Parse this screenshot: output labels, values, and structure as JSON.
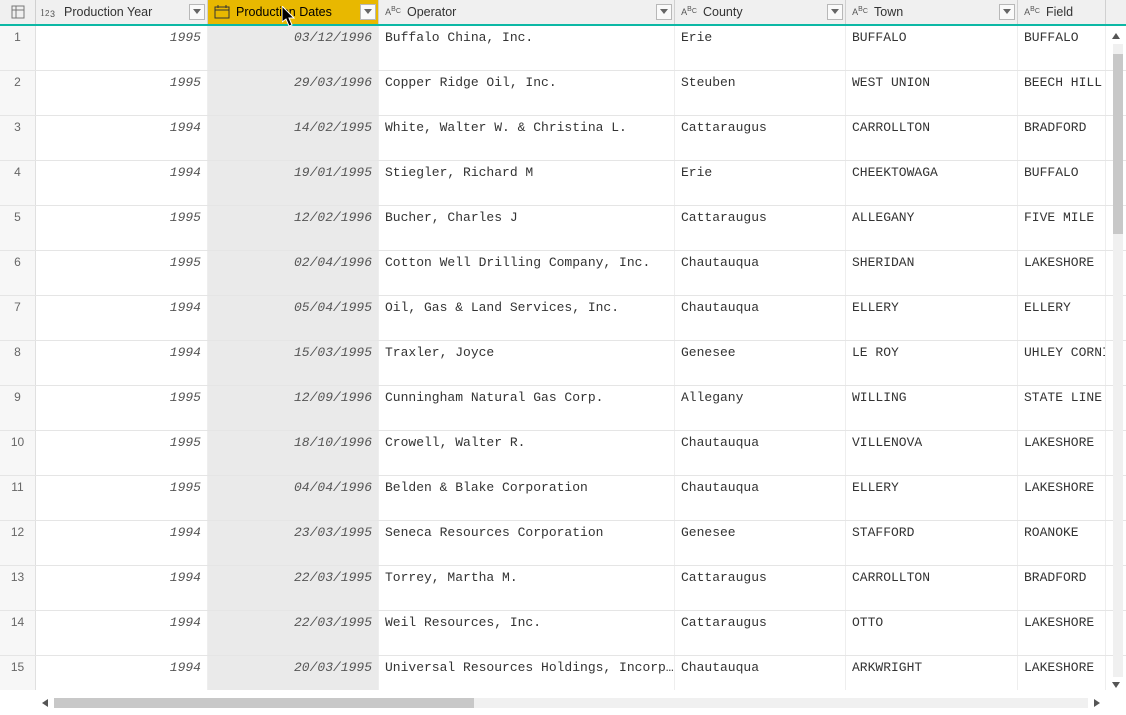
{
  "columns": [
    {
      "key": "year",
      "label": "Production Year",
      "type": "number",
      "selected": false
    },
    {
      "key": "dates",
      "label": "Production Dates",
      "type": "date",
      "selected": true
    },
    {
      "key": "operator",
      "label": "Operator",
      "type": "text",
      "selected": false
    },
    {
      "key": "county",
      "label": "County",
      "type": "text",
      "selected": false
    },
    {
      "key": "town",
      "label": "Town",
      "type": "text",
      "selected": false
    },
    {
      "key": "field",
      "label": "Field",
      "type": "text",
      "selected": false
    }
  ],
  "rows": [
    {
      "n": 1,
      "year": "1995",
      "dates": "03/12/1996",
      "operator": "Buffalo China, Inc.",
      "county": "Erie",
      "town": "BUFFALO",
      "field": "BUFFALO"
    },
    {
      "n": 2,
      "year": "1995",
      "dates": "29/03/1996",
      "operator": "Copper Ridge Oil, Inc.",
      "county": "Steuben",
      "town": "WEST UNION",
      "field": "BEECH HILL"
    },
    {
      "n": 3,
      "year": "1994",
      "dates": "14/02/1995",
      "operator": "White, Walter W. & Christina L.",
      "county": "Cattaraugus",
      "town": "CARROLLTON",
      "field": "BRADFORD"
    },
    {
      "n": 4,
      "year": "1994",
      "dates": "19/01/1995",
      "operator": "Stiegler, Richard M",
      "county": "Erie",
      "town": "CHEEKTOWAGA",
      "field": "BUFFALO"
    },
    {
      "n": 5,
      "year": "1995",
      "dates": "12/02/1996",
      "operator": "Bucher, Charles J",
      "county": "Cattaraugus",
      "town": "ALLEGANY",
      "field": "FIVE MILE"
    },
    {
      "n": 6,
      "year": "1995",
      "dates": "02/04/1996",
      "operator": "Cotton Well Drilling Company,  Inc.",
      "county": "Chautauqua",
      "town": "SHERIDAN",
      "field": "LAKESHORE"
    },
    {
      "n": 7,
      "year": "1994",
      "dates": "05/04/1995",
      "operator": "Oil, Gas & Land Services, Inc.",
      "county": "Chautauqua",
      "town": "ELLERY",
      "field": "ELLERY"
    },
    {
      "n": 8,
      "year": "1994",
      "dates": "15/03/1995",
      "operator": "Traxler, Joyce",
      "county": "Genesee",
      "town": "LE ROY",
      "field": "UHLEY CORNI"
    },
    {
      "n": 9,
      "year": "1995",
      "dates": "12/09/1996",
      "operator": "Cunningham Natural Gas Corp.",
      "county": "Allegany",
      "town": "WILLING",
      "field": "STATE LINE"
    },
    {
      "n": 10,
      "year": "1995",
      "dates": "18/10/1996",
      "operator": "Crowell, Walter R.",
      "county": "Chautauqua",
      "town": "VILLENOVA",
      "field": "LAKESHORE"
    },
    {
      "n": 11,
      "year": "1995",
      "dates": "04/04/1996",
      "operator": "Belden & Blake Corporation",
      "county": "Chautauqua",
      "town": "ELLERY",
      "field": "LAKESHORE"
    },
    {
      "n": 12,
      "year": "1994",
      "dates": "23/03/1995",
      "operator": "Seneca Resources Corporation",
      "county": "Genesee",
      "town": "STAFFORD",
      "field": "ROANOKE"
    },
    {
      "n": 13,
      "year": "1994",
      "dates": "22/03/1995",
      "operator": "Torrey, Martha M.",
      "county": "Cattaraugus",
      "town": "CARROLLTON",
      "field": "BRADFORD"
    },
    {
      "n": 14,
      "year": "1994",
      "dates": "22/03/1995",
      "operator": "Weil Resources, Inc.",
      "county": "Cattaraugus",
      "town": "OTTO",
      "field": "LAKESHORE"
    },
    {
      "n": 15,
      "year": "1994",
      "dates": "20/03/1995",
      "operator": "Universal Resources Holdings, Incorp…",
      "county": "Chautauqua",
      "town": "ARKWRIGHT",
      "field": "LAKESHORE"
    }
  ]
}
